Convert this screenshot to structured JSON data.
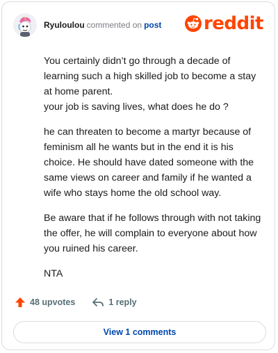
{
  "comment": {
    "username": "Ryuloulou",
    "commented_text": "commented on",
    "post_link": "post",
    "paragraphs": [
      "You certainly didn’t go through a decade of learning such a high skilled job to become a stay at home parent.\nyour job is saving lives, what does he do ?",
      "he can threaten to become a martyr because of feminism all he wants but in the end it is his choice. He should have dated someone with the same views on career and family if he wanted a wife who stays home the old school way.",
      "Be aware that if he follows through with not taking the offer, he will complain to everyone about how you ruined his career.",
      "NTA"
    ]
  },
  "brand": {
    "wordmark": "reddit",
    "color": "#ff4500"
  },
  "actions": {
    "upvotes": "48 upvotes",
    "reply": "1 reply",
    "view_comments": "View 1 comments"
  },
  "icons": {
    "avatar": "avatar-unicorn-icon",
    "logo": "reddit-snoo-icon",
    "upvote": "upvote-arrow-icon",
    "reply": "reply-arrow-icon"
  }
}
